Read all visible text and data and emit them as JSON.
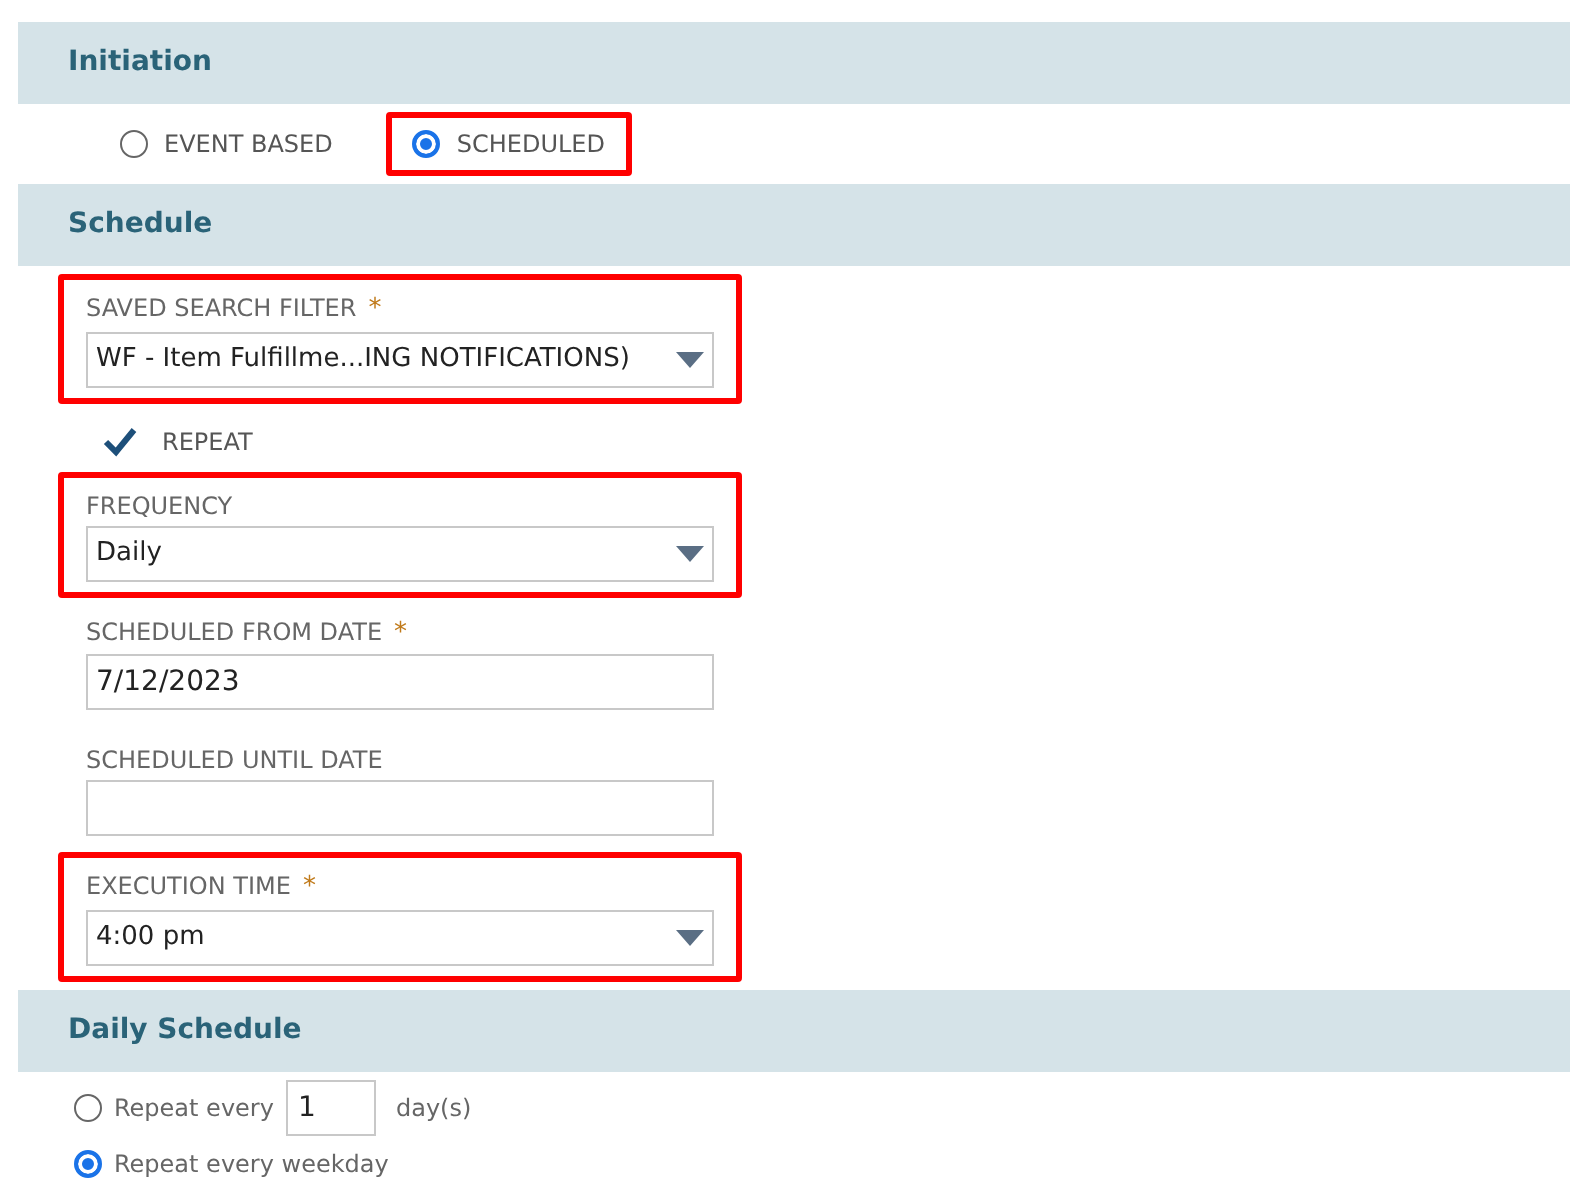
{
  "sections": [
    {
      "title": "Initiation",
      "kind": "radios",
      "options": [
        {
          "label": "EVENT BASED",
          "selected": false,
          "highlighted": false
        },
        {
          "label": "SCHEDULED",
          "selected": true,
          "highlighted": true
        }
      ]
    },
    {
      "title": "Schedule",
      "kind": "fields",
      "fields": [
        {
          "kind": "select",
          "label": "SAVED SEARCH FILTER",
          "required_mark": "*",
          "value": "WF - Item Fulfillme...ING NOTIFICATIONS)",
          "highlighted": true
        },
        {
          "kind": "checkbox",
          "label": "REPEAT",
          "checked": true
        },
        {
          "kind": "select",
          "label": "FREQUENCY",
          "value": "Daily",
          "highlighted": true
        },
        {
          "kind": "input",
          "label": "SCHEDULED FROM DATE",
          "required_mark": "*",
          "value": "7/12/2023",
          "highlighted": false
        },
        {
          "kind": "input",
          "label": "SCHEDULED UNTIL DATE",
          "highlighted": false
        },
        {
          "kind": "select",
          "label": "EXECUTION TIME",
          "required_mark": "*",
          "value": "4:00 pm",
          "highlighted": true
        }
      ]
    },
    {
      "title": "Daily Schedule",
      "kind": "daily",
      "options": [
        {
          "label": "Repeat every",
          "value": "1",
          "suffix": "day(s)",
          "selected": false
        },
        {
          "label": "Repeat every weekday",
          "selected": true
        }
      ]
    }
  ]
}
